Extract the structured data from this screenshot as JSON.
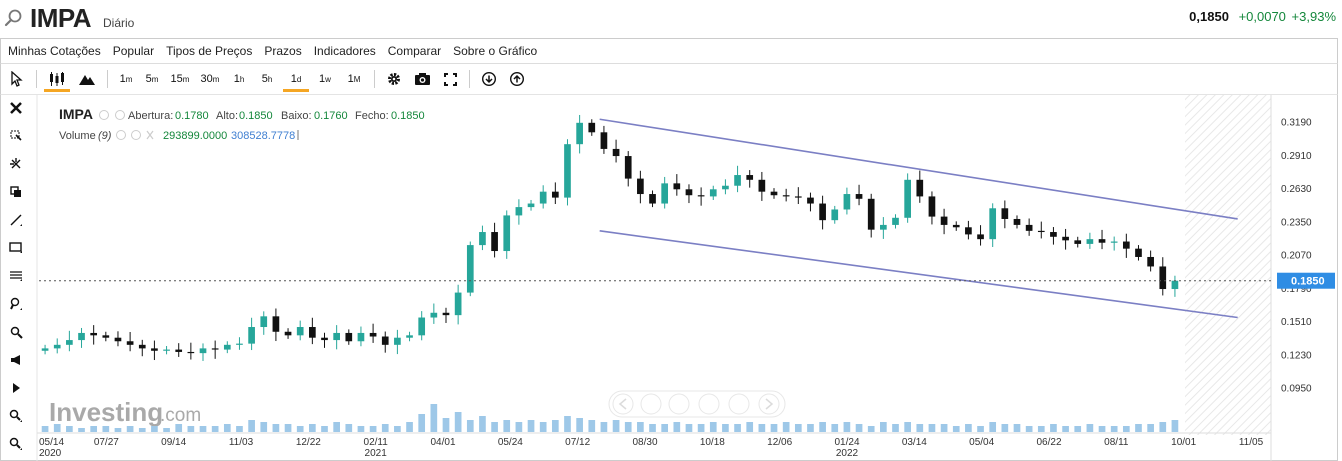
{
  "header": {
    "symbol": "IMPA",
    "period": "Diário",
    "price": "0,1850",
    "change": "+0,0070",
    "change_pct": "+3,93%"
  },
  "menu": [
    "Minhas Cotações",
    "Popular",
    "Tipos de Preços",
    "Prazos",
    "Indicadores",
    "Comparar",
    "Sobre o Gráfico"
  ],
  "toolbar": {
    "intervals": [
      {
        "num": "1",
        "unit": "m"
      },
      {
        "num": "5",
        "unit": "m"
      },
      {
        "num": "15",
        "unit": "m"
      },
      {
        "num": "30",
        "unit": "m"
      },
      {
        "num": "1",
        "unit": "h"
      },
      {
        "num": "5",
        "unit": "h"
      },
      {
        "num": "1",
        "unit": "d"
      },
      {
        "num": "1",
        "unit": "w"
      },
      {
        "num": "1",
        "unit": "M"
      }
    ],
    "active_interval": "1d"
  },
  "legend": {
    "symbol": "IMPA",
    "open_label": "Abertura:",
    "open": "0.1780",
    "high_label": "Alto:",
    "high": "0.1850",
    "low_label": "Baixo:",
    "low": "0.1760",
    "close_label": "Fecho:",
    "close": "0.1850",
    "volume_label": "Volume",
    "volume_period": "(9)",
    "volume_value": "293899.0000",
    "volume_avg": "308528.7778"
  },
  "watermark": {
    "brand": "Investing",
    "suffix": ".com"
  },
  "last_price_tag": "0.1850",
  "colors": {
    "up": "#26a69a",
    "down": "#111111",
    "price_tag": "#2f8de4",
    "channel": "#7b7fc4",
    "accent": "#f5a623",
    "green_text": "#14873b",
    "blue_text": "#3f7fd1"
  },
  "chart_data": {
    "type": "candlestick",
    "price_scale_labels": [
      "0.3190",
      "0.2910",
      "0.2630",
      "0.2350",
      "0.2070",
      "0.1790",
      "0.1510",
      "0.1230",
      "0.0950"
    ],
    "ylim": [
      0.082,
      0.333
    ],
    "x_ticks": [
      {
        "label": "05/14",
        "sub": "2020"
      },
      {
        "label": "07/27",
        "sub": ""
      },
      {
        "label": "09/14",
        "sub": ""
      },
      {
        "label": "11/03",
        "sub": ""
      },
      {
        "label": "12/22",
        "sub": ""
      },
      {
        "label": "02/11",
        "sub": "2021"
      },
      {
        "label": "04/01",
        "sub": ""
      },
      {
        "label": "05/24",
        "sub": ""
      },
      {
        "label": "07/12",
        "sub": ""
      },
      {
        "label": "08/30",
        "sub": ""
      },
      {
        "label": "10/18",
        "sub": ""
      },
      {
        "label": "12/06",
        "sub": ""
      },
      {
        "label": "01/24",
        "sub": "2022"
      },
      {
        "label": "03/14",
        "sub": ""
      },
      {
        "label": "05/04",
        "sub": ""
      },
      {
        "label": "06/22",
        "sub": ""
      },
      {
        "label": "08/11",
        "sub": ""
      },
      {
        "label": "10/01",
        "sub": ""
      },
      {
        "label": "11/05",
        "sub": ""
      }
    ],
    "close_series": [
      0.128,
      0.131,
      0.135,
      0.141,
      0.139,
      0.137,
      0.134,
      0.131,
      0.128,
      0.126,
      0.127,
      0.125,
      0.124,
      0.128,
      0.127,
      0.131,
      0.132,
      0.146,
      0.155,
      0.142,
      0.139,
      0.146,
      0.137,
      0.135,
      0.141,
      0.134,
      0.141,
      0.138,
      0.131,
      0.137,
      0.139,
      0.154,
      0.158,
      0.156,
      0.175,
      0.215,
      0.226,
      0.21,
      0.24,
      0.247,
      0.25,
      0.26,
      0.255,
      0.3,
      0.318,
      0.31,
      0.296,
      0.29,
      0.271,
      0.258,
      0.25,
      0.267,
      0.262,
      0.257,
      0.256,
      0.262,
      0.265,
      0.274,
      0.27,
      0.26,
      0.257,
      0.256,
      0.255,
      0.25,
      0.236,
      0.245,
      0.258,
      0.254,
      0.228,
      0.232,
      0.238,
      0.27,
      0.256,
      0.239,
      0.232,
      0.23,
      0.224,
      0.22,
      0.246,
      0.237,
      0.232,
      0.227,
      0.226,
      0.222,
      0.219,
      0.216,
      0.22,
      0.217,
      0.218,
      0.212,
      0.205,
      0.197,
      0.178,
      0.185
    ],
    "volume_series": [
      3,
      4,
      3,
      2,
      3,
      3,
      2,
      3,
      2,
      3,
      2,
      4,
      3,
      3,
      3,
      4,
      3,
      6,
      5,
      4,
      4,
      3,
      4,
      3,
      5,
      4,
      3,
      3,
      4,
      3,
      5,
      9,
      14,
      7,
      10,
      6,
      8,
      5,
      6,
      5,
      6,
      5,
      6,
      8,
      7,
      6,
      5,
      6,
      5,
      5,
      4,
      4,
      5,
      4,
      4,
      5,
      4,
      4,
      5,
      4,
      4,
      5,
      4,
      4,
      5,
      4,
      5,
      4,
      3,
      5,
      4,
      5,
      4,
      4,
      4,
      3,
      4,
      3,
      5,
      4,
      4,
      3,
      3,
      4,
      3,
      3,
      4,
      3,
      3,
      3,
      4,
      4,
      5,
      6
    ],
    "channel": {
      "upper": {
        "from": [
          "07/12",
          0.321
        ],
        "to": [
          "10/01",
          0.237
        ]
      },
      "lower": {
        "from": [
          "07/12",
          0.227
        ],
        "to": [
          "10/01",
          0.154
        ]
      }
    },
    "last_price": 0.185
  }
}
